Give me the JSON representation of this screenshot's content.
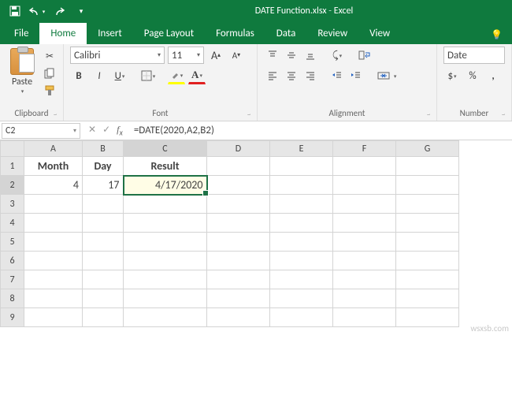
{
  "title": {
    "doc": "DATE Function.xlsx",
    "sep": "-",
    "app": "Excel"
  },
  "tabs": [
    "File",
    "Home",
    "Insert",
    "Page Layout",
    "Formulas",
    "Data",
    "Review",
    "View"
  ],
  "active_tab": "Home",
  "ribbon": {
    "clipboard": {
      "label": "Clipboard",
      "paste": "Paste"
    },
    "font": {
      "label": "Font",
      "name": "Calibri",
      "size": "11",
      "btns": {
        "bold": "B",
        "italic": "I",
        "underline": "U",
        "increase": "A",
        "decrease": "A"
      }
    },
    "alignment": {
      "label": "Alignment"
    },
    "number": {
      "label": "Number",
      "format": "Date"
    }
  },
  "namebox": "C2",
  "formula": "=DATE(2020,A2,B2)",
  "columns": [
    "A",
    "B",
    "C",
    "D",
    "E",
    "F",
    "G"
  ],
  "rows": [
    "1",
    "2",
    "3",
    "4",
    "5",
    "6",
    "7",
    "8",
    "9"
  ],
  "cells": {
    "A1": "Month",
    "B1": "Day",
    "C1": "Result",
    "A2": "4",
    "B2": "17",
    "C2": "4/17/2020"
  },
  "watermark": "wsxsb.com"
}
